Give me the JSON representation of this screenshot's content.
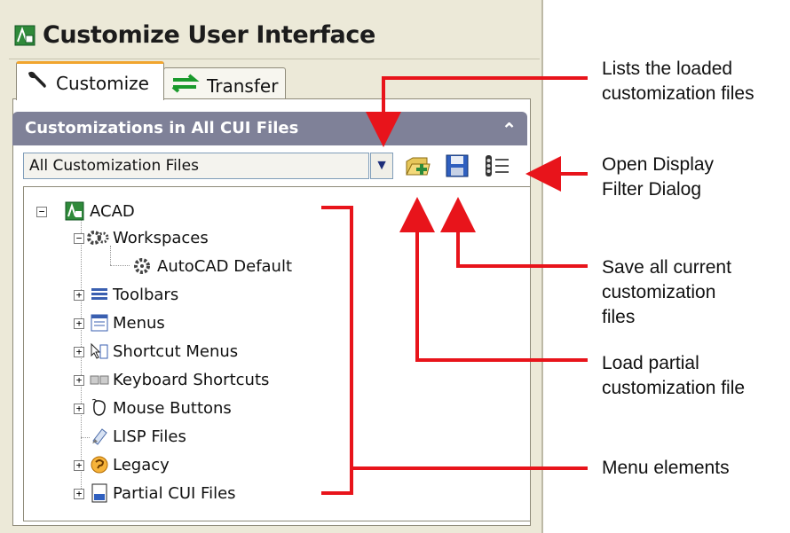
{
  "window": {
    "title": "Customize User Interface"
  },
  "tabs": [
    {
      "label": "Customize",
      "active": true
    },
    {
      "label": "Transfer",
      "active": false
    }
  ],
  "panel": {
    "title": "Customizations in All CUI Files",
    "dropdown_value": "All Customization Files"
  },
  "tree": {
    "root": "ACAD",
    "items": [
      {
        "label": "Workspaces",
        "icon": "gears-icon"
      },
      {
        "label": "AutoCAD Default",
        "icon": "gear-icon"
      },
      {
        "label": "Toolbars",
        "icon": "toolbar-icon"
      },
      {
        "label": "Menus",
        "icon": "menu-icon"
      },
      {
        "label": "Shortcut Menus",
        "icon": "shortcut-menu-icon"
      },
      {
        "label": "Keyboard Shortcuts",
        "icon": "keyboard-icon"
      },
      {
        "label": "Mouse Buttons",
        "icon": "mouse-icon"
      },
      {
        "label": "LISP Files",
        "icon": "lisp-icon"
      },
      {
        "label": "Legacy",
        "icon": "legacy-icon"
      },
      {
        "label": "Partial CUI Files",
        "icon": "cui-file-icon"
      }
    ]
  },
  "callouts": {
    "lists_loaded_1": "Lists the loaded",
    "lists_loaded_2": "customization files",
    "open_display_1": "Open Display",
    "open_display_2": "Filter Dialog",
    "save_all_1": "Save all current",
    "save_all_2": "customization",
    "save_all_3": "files",
    "load_partial_1": "Load partial",
    "load_partial_2": "customization file",
    "menu_elements": "Menu elements"
  },
  "colors": {
    "arrow": "#e8141b",
    "panel_header": "#7f8198",
    "active_tab_accent": "#f1a52e"
  }
}
